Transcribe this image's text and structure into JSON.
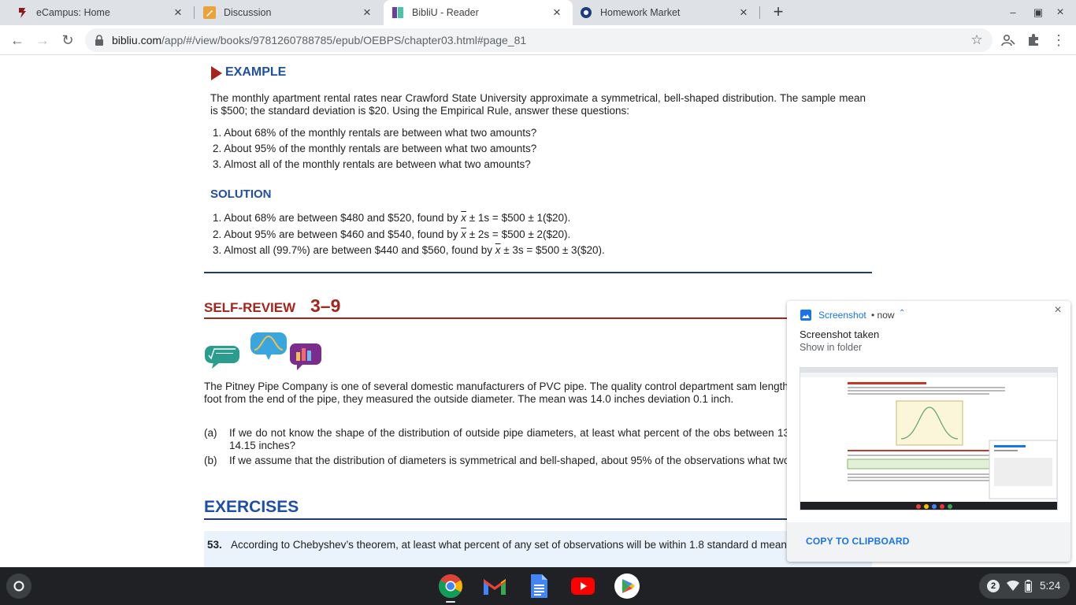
{
  "tabs": [
    {
      "label": "eCampus: Home"
    },
    {
      "label": "Discussion"
    },
    {
      "label": "BibliU - Reader",
      "active": true
    },
    {
      "label": "Homework Market"
    }
  ],
  "toolbar": {
    "url_host": "bibliu.com",
    "url_path": "/app/#/view/books/9781260788785/epub/OEBPS/chapter03.html#page_81"
  },
  "content": {
    "example_title": "EXAMPLE",
    "example_para": "The monthly apartment rental rates near Crawford State University approximate a symmetrical, bell-shaped distribution. The sample mean is $500; the standard deviation is $20. Using the Empirical Rule, answer these questions:",
    "questions": [
      "1. About 68% of the monthly rentals are between what two amounts?",
      "2. About 95% of the monthly rentals are between what two amounts?",
      "3. Almost all of the monthly rentals are between what two amounts?"
    ],
    "solution_title": "SOLUTION",
    "solutions": [
      {
        "pre": "1. About 68% are between $480 and $520, found by ",
        "x": "x",
        "post": " ± 1s = $500 ± 1($20)."
      },
      {
        "pre": "2. About 95% are between $460 and $540, found by ",
        "x": "x",
        "post": " ± 2s = $500 ± 2($20)."
      },
      {
        "pre": "3. Almost all (99.7%) are between $440 and $560, found by ",
        "x": "x",
        "post": " ± 3s = $500 ± 3($20)."
      }
    ],
    "self_review_title": "SELF-REVIEW",
    "self_review_number": "3–9",
    "sr_para": "The Pitney Pipe Company is one of several domestic manufacturers of PVC pipe. The quality control department sam lengths. At a point 1 foot from the end of the pipe, they measured the outside diameter. The mean was 14.0 inches deviation 0.1 inch.",
    "sr_items": [
      {
        "label": "(a)",
        "text": "If we do not know the shape of the distribution of outside pipe diameters, at least what percent of the obs between 13.85 inches and 14.15 inches?"
      },
      {
        "label": "(b)",
        "text": "If we assume that the distribution of diameters is symmetrical and bell-shaped, about 95% of the observations what two values?"
      }
    ],
    "exercises_title": "EXERCISES",
    "exercise_num": "53.",
    "exercise_text": "According to Chebyshev’s theorem, at least what percent of any set of observations will be within 1.8 standard d mean?"
  },
  "notification": {
    "app": "Screenshot",
    "time": "• now",
    "title": "Screenshot taken",
    "subtitle": "Show in folder",
    "action": "COPY TO CLIPBOARD"
  },
  "shelf": {
    "apps": [
      "chrome-icon",
      "gmail-icon",
      "docs-icon",
      "youtube-icon",
      "play-store-icon"
    ],
    "notification_count": "2",
    "time": "5:24"
  }
}
